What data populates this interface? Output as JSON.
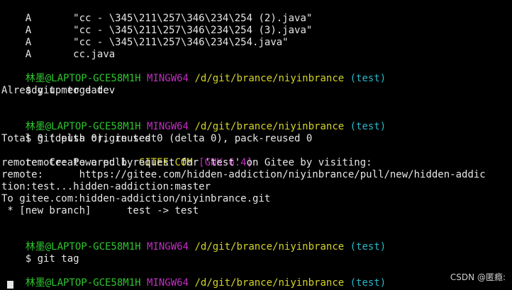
{
  "terminal": {
    "status_lines": [
      {
        "code": "A",
        "path": "\"cc - \\345\\211\\257\\346\\234\\254 (2).java\""
      },
      {
        "code": "A",
        "path": "\"cc - \\345\\211\\257\\346\\234\\254 (3).java\""
      },
      {
        "code": "A",
        "path": "\"cc - \\345\\211\\257\\346\\234\\254.java\""
      },
      {
        "code": "A",
        "path": "cc.java"
      }
    ],
    "prompt": {
      "user_host": "林墨@LAPTOP-GCE58M1H",
      "shell": "MINGW64",
      "cwd": "/d/git/brance/niyinbrance",
      "branch": "(test)",
      "symbol": "$"
    },
    "blocks": [
      {
        "command": "git merge dev",
        "output": [
          "Already up to date."
        ]
      },
      {
        "command": "git push origin test",
        "output": [
          "Total 0 (delta 0), reused 0 (delta 0), pack-reused 0",
          "remote: Powered by ",
          "remote: Create a pull request for 'test' on Gitee by visiting:",
          "remote:      https://gitee.com/hidden-addiction/niyinbrance/pull/new/hidden-addic",
          "tion:test...hidden-addiction:master",
          "To gitee.com:hidden-addiction/niyinbrance.git",
          " * [new branch]      test -> test"
        ],
        "powered_by": {
          "host": "GITEE.COM",
          "version": "[GNK-6.4]"
        }
      },
      {
        "command": "git tag",
        "output": []
      }
    ],
    "final_prompt_symbol": "$"
  },
  "watermark": "CSDN @匿瘾:",
  "colors": {
    "background": "#000000",
    "text": "#e6e6e6",
    "user_host": "#2ec52e",
    "shell": "#c22ec2",
    "cwd": "#d3d32a",
    "branch": "#2ab7c7"
  }
}
